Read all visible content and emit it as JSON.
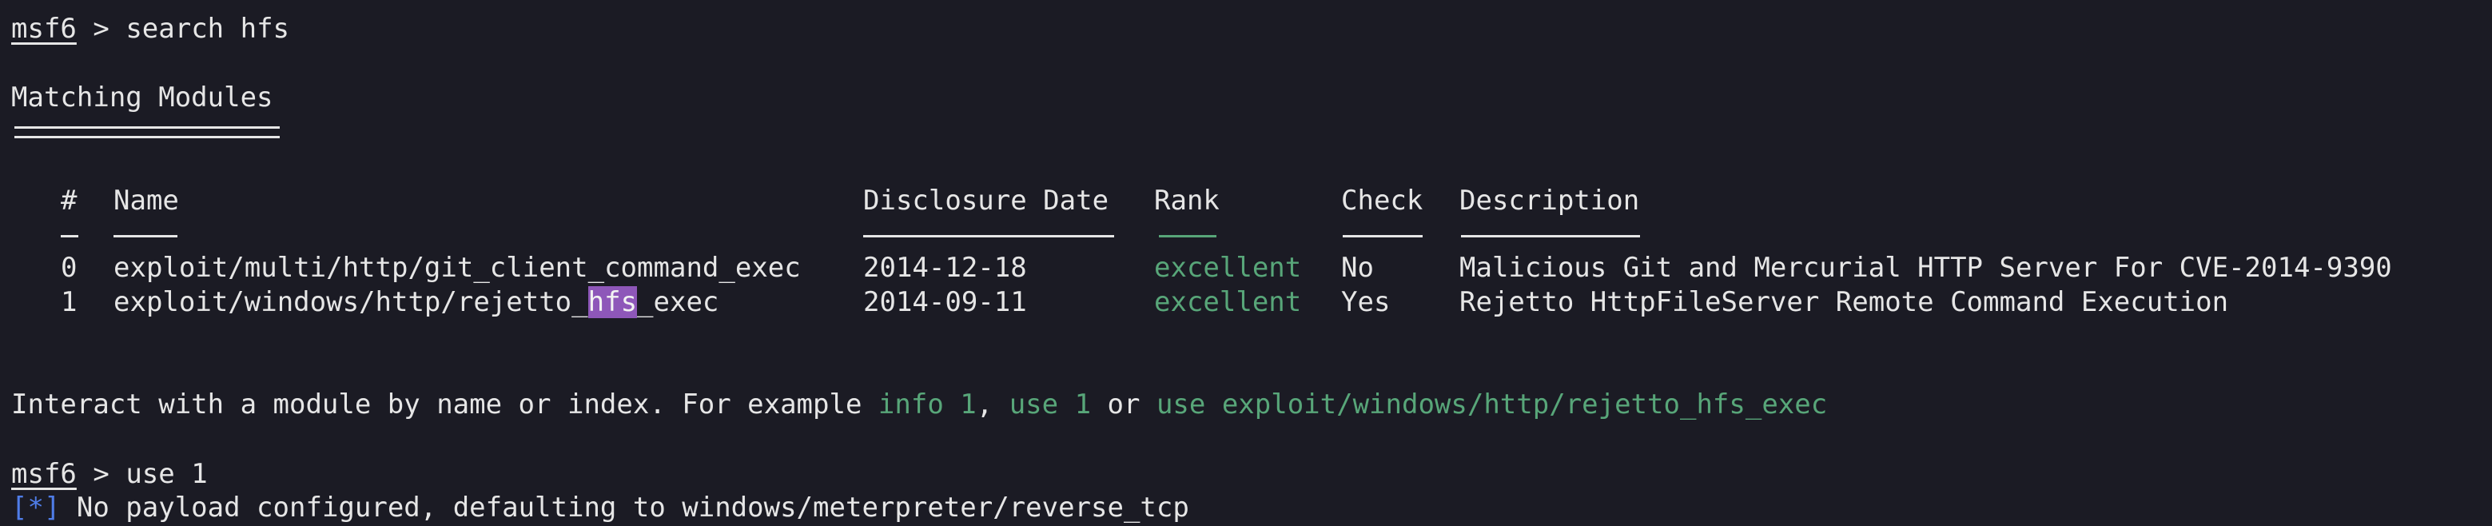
{
  "prompt1": {
    "label": "msf6",
    "sep": " > ",
    "cmd": "search hfs"
  },
  "section": {
    "title": "Matching Modules"
  },
  "table": {
    "headers": [
      "#",
      "Name",
      "Disclosure Date",
      "Rank",
      "Check",
      "Description"
    ],
    "rows": [
      {
        "num": "0",
        "name_pre": "exploit/multi/http/git_client_command_exec",
        "name_hl": "",
        "name_post": "",
        "date": "2014-12-18",
        "rank": "excellent",
        "check": "No",
        "desc": "Malicious Git and Mercurial HTTP Server For CVE-2014-9390"
      },
      {
        "num": "1",
        "name_pre": "exploit/windows/http/rejetto_",
        "name_hl": "hfs",
        "name_post": "_exec",
        "date": "2014-09-11",
        "rank": "excellent",
        "check": "Yes",
        "desc": "Rejetto HttpFileServer Remote Command Execution"
      }
    ]
  },
  "hint": {
    "text1": "Interact with a module by name or index. For example ",
    "info": "info 1",
    "comma": ", ",
    "use1": "use 1",
    "or": " or ",
    "usefull": "use exploit/windows/http/rejetto_hfs_exec"
  },
  "prompt2": {
    "label": "msf6",
    "sep": " > ",
    "cmd": "use 1"
  },
  "status": {
    "marker": "[*]",
    "text": " No payload configured, defaulting to windows/meterpreter/reverse_tcp"
  },
  "colors": {
    "background": "#1b1b24",
    "text": "#e6e6e6",
    "green": "#58a679",
    "blue": "#4f7de8",
    "highlight": "#8e57b9"
  }
}
